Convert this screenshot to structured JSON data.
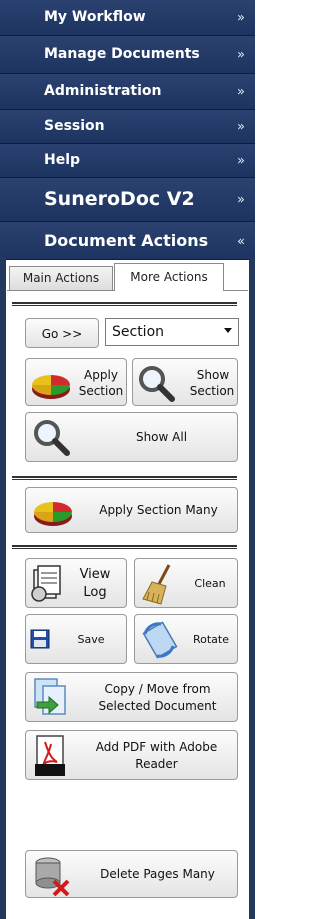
{
  "nav": {
    "my_workflow": "My Workflow",
    "manage_documents": "Manage Documents",
    "administration": "Administration",
    "session": "Session",
    "help": "Help",
    "app_name": "SuneroDoc V2",
    "document_actions": "Document Actions"
  },
  "tabs": {
    "main": "Main Actions",
    "more": "More Actions"
  },
  "actions": {
    "go": "Go >>",
    "section_select_value": "Section",
    "apply_section": [
      "Apply",
      "Section"
    ],
    "show_section": [
      "Show",
      "Section"
    ],
    "show_all": "Show All",
    "apply_section_many": "Apply Section Many",
    "view_log": [
      "View",
      "Log"
    ],
    "clean": "Clean",
    "save": "Save",
    "rotate": "Rotate",
    "copy_move": [
      "Copy / Move from",
      "Selected Document"
    ],
    "add_pdf": [
      "Add PDF with Adobe",
      "Reader"
    ],
    "delete_pages_many": "Delete Pages Many"
  },
  "colors": {
    "nav_bg": "#24396a",
    "panel_border": "#23375f"
  }
}
